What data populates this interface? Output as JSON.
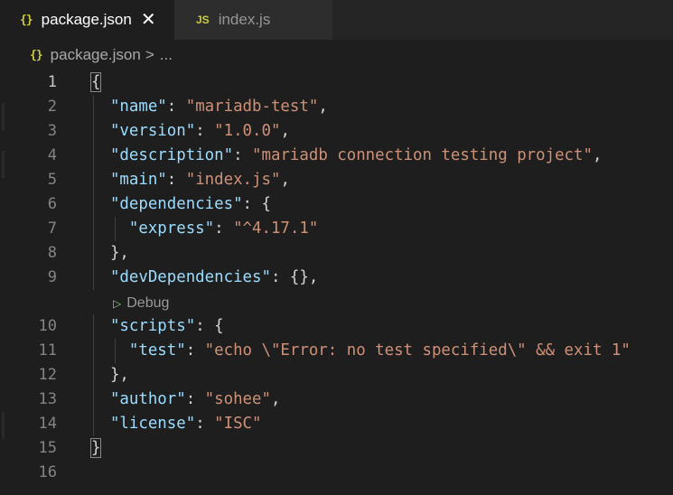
{
  "tabs": [
    {
      "label": "package.json",
      "icon": "{}",
      "active": true,
      "close": "✕"
    },
    {
      "label": "index.js",
      "icon": "JS",
      "active": false
    }
  ],
  "breadcrumb": {
    "icon": "{}",
    "file": "package.json",
    "separator": ">",
    "more": "..."
  },
  "codelens": {
    "label": "Debug"
  },
  "lines": [
    {
      "n": "1",
      "tokens": [
        {
          "t": "{",
          "c": "punc",
          "hl": true
        }
      ]
    },
    {
      "n": "2",
      "tokens": [
        {
          "t": "  ",
          "c": "punc"
        },
        {
          "t": "\"name\"",
          "c": "key"
        },
        {
          "t": ": ",
          "c": "punc"
        },
        {
          "t": "\"mariadb-test\"",
          "c": "str"
        },
        {
          "t": ",",
          "c": "punc"
        }
      ]
    },
    {
      "n": "3",
      "tokens": [
        {
          "t": "  ",
          "c": "punc"
        },
        {
          "t": "\"version\"",
          "c": "key"
        },
        {
          "t": ": ",
          "c": "punc"
        },
        {
          "t": "\"1.0.0\"",
          "c": "str"
        },
        {
          "t": ",",
          "c": "punc"
        }
      ]
    },
    {
      "n": "4",
      "tokens": [
        {
          "t": "  ",
          "c": "punc"
        },
        {
          "t": "\"description\"",
          "c": "key"
        },
        {
          "t": ": ",
          "c": "punc"
        },
        {
          "t": "\"mariadb connection testing project\"",
          "c": "str"
        },
        {
          "t": ",",
          "c": "punc"
        }
      ]
    },
    {
      "n": "5",
      "tokens": [
        {
          "t": "  ",
          "c": "punc"
        },
        {
          "t": "\"main\"",
          "c": "key"
        },
        {
          "t": ": ",
          "c": "punc"
        },
        {
          "t": "\"index.js\"",
          "c": "str"
        },
        {
          "t": ",",
          "c": "punc"
        }
      ]
    },
    {
      "n": "6",
      "tokens": [
        {
          "t": "  ",
          "c": "punc"
        },
        {
          "t": "\"dependencies\"",
          "c": "key"
        },
        {
          "t": ": {",
          "c": "punc"
        }
      ]
    },
    {
      "n": "7",
      "tokens": [
        {
          "t": "    ",
          "c": "punc"
        },
        {
          "t": "\"express\"",
          "c": "key"
        },
        {
          "t": ": ",
          "c": "punc"
        },
        {
          "t": "\"^4.17.1\"",
          "c": "str"
        }
      ]
    },
    {
      "n": "8",
      "tokens": [
        {
          "t": "  },",
          "c": "punc"
        }
      ]
    },
    {
      "n": "9",
      "tokens": [
        {
          "t": "  ",
          "c": "punc"
        },
        {
          "t": "\"devDependencies\"",
          "c": "key"
        },
        {
          "t": ": {},",
          "c": "punc"
        }
      ]
    },
    {
      "n": "10",
      "tokens": [
        {
          "t": "  ",
          "c": "punc"
        },
        {
          "t": "\"scripts\"",
          "c": "key"
        },
        {
          "t": ": {",
          "c": "punc"
        }
      ]
    },
    {
      "n": "11",
      "tokens": [
        {
          "t": "    ",
          "c": "punc"
        },
        {
          "t": "\"test\"",
          "c": "key"
        },
        {
          "t": ": ",
          "c": "punc"
        },
        {
          "t": "\"echo \\\"Error: no test specified\\\" && exit 1\"",
          "c": "str"
        }
      ]
    },
    {
      "n": "12",
      "tokens": [
        {
          "t": "  },",
          "c": "punc"
        }
      ]
    },
    {
      "n": "13",
      "tokens": [
        {
          "t": "  ",
          "c": "punc"
        },
        {
          "t": "\"author\"",
          "c": "key"
        },
        {
          "t": ": ",
          "c": "punc"
        },
        {
          "t": "\"sohee\"",
          "c": "str"
        },
        {
          "t": ",",
          "c": "punc"
        }
      ]
    },
    {
      "n": "14",
      "tokens": [
        {
          "t": "  ",
          "c": "punc"
        },
        {
          "t": "\"license\"",
          "c": "key"
        },
        {
          "t": ": ",
          "c": "punc"
        },
        {
          "t": "\"ISC\"",
          "c": "str"
        }
      ]
    },
    {
      "n": "15",
      "tokens": [
        {
          "t": "}",
          "c": "punc",
          "hl": true
        }
      ]
    },
    {
      "n": "16",
      "tokens": []
    }
  ],
  "colors": {
    "key": "#9cdcfe",
    "string": "#ce9178",
    "punctuation": "#d4d4d4",
    "icon": "#cbcb41"
  }
}
